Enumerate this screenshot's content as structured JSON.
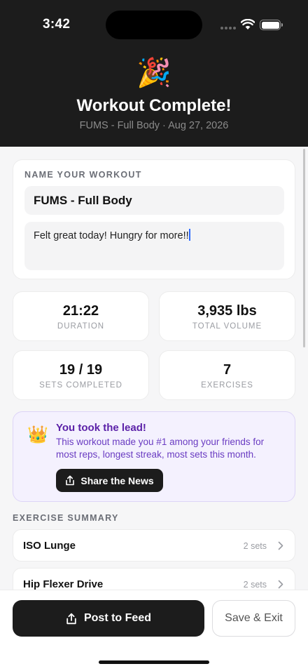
{
  "status_bar": {
    "time": "3:42"
  },
  "header": {
    "emoji": "🎉",
    "title": "Workout Complete!",
    "subtitle": "FUMS - Full Body · Aug 27, 2026"
  },
  "name_card": {
    "label": "NAME YOUR WORKOUT",
    "name_value": "FUMS - Full Body",
    "notes_value": "Felt great today! Hungry for more!!"
  },
  "stats": [
    {
      "value": "21:22",
      "label": "DURATION"
    },
    {
      "value": "3,935 lbs",
      "label": "TOTAL VOLUME"
    },
    {
      "value": "19 / 19",
      "label": "SETS COMPLETED"
    },
    {
      "value": "7",
      "label": "EXERCISES"
    }
  ],
  "lead": {
    "emoji": "👑",
    "title": "You took the lead!",
    "text": "This workout made you #1 among your friends for most reps, longest streak, most sets this month.",
    "button_label": "Share the News"
  },
  "exercise_summary": {
    "label": "EXERCISE SUMMARY",
    "items": [
      {
        "name": "ISO Lunge",
        "sets": "2 sets"
      },
      {
        "name": "Hip Flexer Drive",
        "sets": "2 sets"
      }
    ]
  },
  "actions": {
    "post_label": "Post to Feed",
    "save_label": "Save & Exit"
  }
}
